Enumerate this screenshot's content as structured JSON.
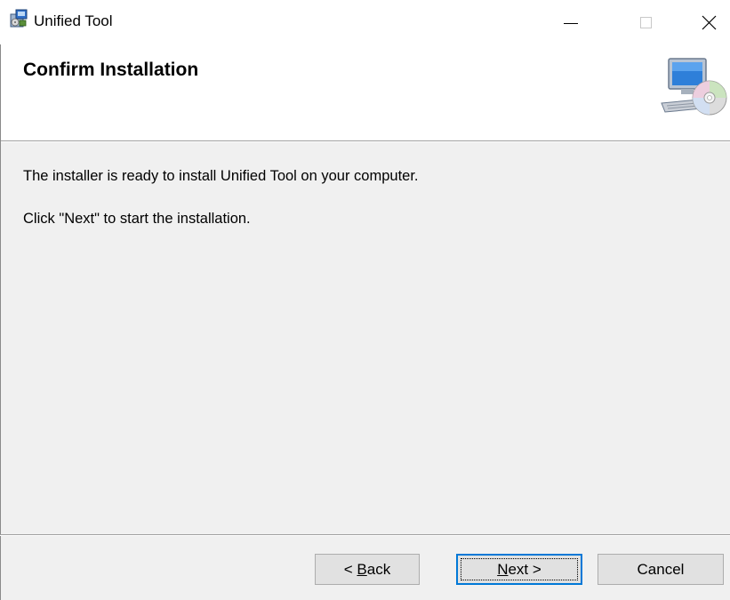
{
  "window": {
    "title": "Unified Tool",
    "minimize_icon": "minimize-icon",
    "maximize_icon": "maximize-icon",
    "close_icon": "close-icon",
    "close_glyph": "✕"
  },
  "banner": {
    "title": "Confirm Installation",
    "icon": "computer-cd-icon"
  },
  "body": {
    "line1": "The installer is ready to install Unified Tool on your computer.",
    "line2": "Click \"Next\" to start the installation."
  },
  "buttons": {
    "back_prefix": "< ",
    "back_mnemonic": "B",
    "back_rest": "ack",
    "next_mnemonic": "N",
    "next_rest": "ext >",
    "cancel": "Cancel"
  },
  "colors": {
    "window_bg": "#f0f0f0",
    "header_bg": "#ffffff",
    "focus_border": "#0078d7"
  }
}
